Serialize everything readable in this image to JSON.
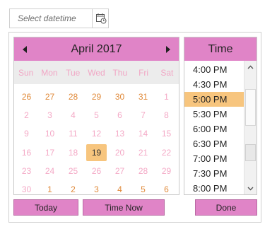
{
  "input": {
    "placeholder": "Select datetime"
  },
  "calendar": {
    "title": "April 2017",
    "weekdays": [
      "Sun",
      "Mon",
      "Tue",
      "Wed",
      "Thu",
      "Fri",
      "Sat"
    ],
    "days": [
      {
        "label": "26",
        "other": true
      },
      {
        "label": "27",
        "other": true
      },
      {
        "label": "28",
        "other": true
      },
      {
        "label": "29",
        "other": true
      },
      {
        "label": "30",
        "other": true
      },
      {
        "label": "31",
        "other": true
      },
      {
        "label": "1",
        "other": false
      },
      {
        "label": "2",
        "other": false
      },
      {
        "label": "3",
        "other": false
      },
      {
        "label": "4",
        "other": false
      },
      {
        "label": "5",
        "other": false
      },
      {
        "label": "6",
        "other": false
      },
      {
        "label": "7",
        "other": false
      },
      {
        "label": "8",
        "other": false
      },
      {
        "label": "9",
        "other": false
      },
      {
        "label": "10",
        "other": false
      },
      {
        "label": "11",
        "other": false
      },
      {
        "label": "12",
        "other": false
      },
      {
        "label": "13",
        "other": false
      },
      {
        "label": "14",
        "other": false
      },
      {
        "label": "15",
        "other": false
      },
      {
        "label": "16",
        "other": false
      },
      {
        "label": "17",
        "other": false
      },
      {
        "label": "18",
        "other": false
      },
      {
        "label": "19",
        "other": false,
        "selected": true
      },
      {
        "label": "20",
        "other": false
      },
      {
        "label": "21",
        "other": false
      },
      {
        "label": "22",
        "other": false
      },
      {
        "label": "23",
        "other": false
      },
      {
        "label": "24",
        "other": false
      },
      {
        "label": "25",
        "other": false
      },
      {
        "label": "26",
        "other": false
      },
      {
        "label": "27",
        "other": false
      },
      {
        "label": "28",
        "other": false
      },
      {
        "label": "29",
        "other": false
      },
      {
        "label": "30",
        "other": false
      },
      {
        "label": "1",
        "other": true
      },
      {
        "label": "2",
        "other": true
      },
      {
        "label": "3",
        "other": true
      },
      {
        "label": "4",
        "other": true
      },
      {
        "label": "5",
        "other": true
      },
      {
        "label": "6",
        "other": true
      }
    ]
  },
  "time": {
    "title": "Time",
    "items": [
      {
        "label": "4:00 PM"
      },
      {
        "label": "4:30 PM"
      },
      {
        "label": "5:00 PM",
        "selected": true
      },
      {
        "label": "5:30 PM"
      },
      {
        "label": "6:00 PM"
      },
      {
        "label": "6:30 PM"
      },
      {
        "label": "7:00 PM"
      },
      {
        "label": "7:30 PM"
      },
      {
        "label": "8:00 PM"
      }
    ]
  },
  "buttons": {
    "today": "Today",
    "time_now": "Time Now",
    "done": "Done"
  },
  "colors": {
    "header": "#e084c7",
    "selected": "#f7c57e",
    "other_month": "#e08a3a",
    "current_month": "#f4a9c6"
  }
}
